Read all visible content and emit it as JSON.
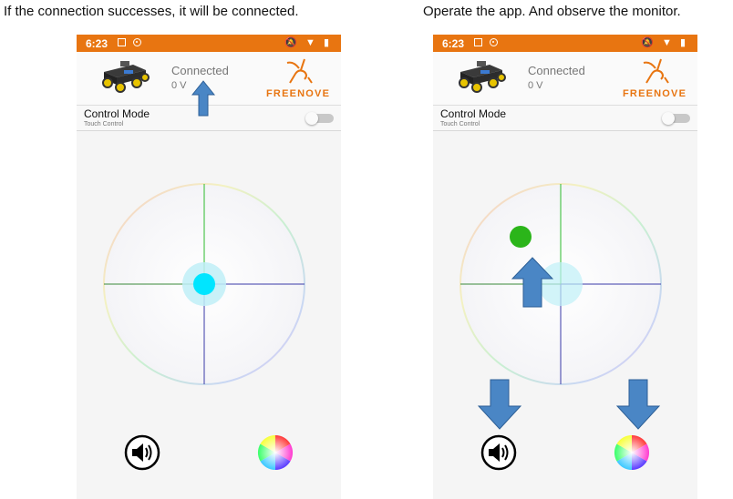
{
  "captions": {
    "left": "If the connection successes, it will be connected.",
    "right": "Operate the app. And observe the monitor."
  },
  "phones": [
    {
      "status": {
        "time": "6:23",
        "right_icons": "🔕 ▼ ▮"
      },
      "header": {
        "connection": "Connected",
        "voltage": "0 V",
        "logo": "FREENOVE"
      },
      "mode": {
        "title": "Control Mode",
        "subtitle": "Touch Control",
        "toggle_on": false
      }
    },
    {
      "status": {
        "time": "6:23",
        "right_icons": "🔕 ▼ ▮"
      },
      "header": {
        "connection": "Connected",
        "voltage": "0 V",
        "logo": "FREENOVE"
      },
      "mode": {
        "title": "Control Mode",
        "subtitle": "Touch Control",
        "toggle_on": false
      }
    }
  ],
  "colors": {
    "status_bar": "#e87511",
    "brand": "#e87511",
    "knob_center": "#00e5ff",
    "knob_moved": "#2bb51a",
    "annotation_arrow": "#4a86c5"
  },
  "icons": {
    "speaker": "speaker-icon",
    "color_wheel": "color-wheel-icon",
    "car": "car-image",
    "arrow": "arrow-annotation-icon"
  }
}
